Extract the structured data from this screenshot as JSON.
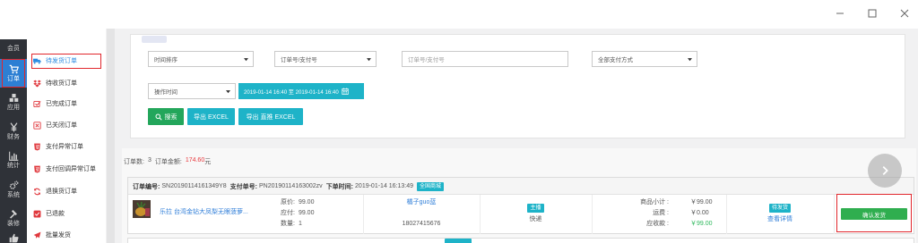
{
  "window_controls": {
    "minimize": "minimize-icon",
    "maximize": "maximize-icon",
    "close": "close-icon"
  },
  "nav": {
    "items": [
      {
        "label": "会员"
      },
      {
        "label": "订单",
        "icon": "cart-icon",
        "active": true
      },
      {
        "label": "应用",
        "icon": "cubes-icon"
      },
      {
        "label": "财务",
        "icon": "yen-icon"
      },
      {
        "label": "统计",
        "icon": "bar-chart-icon"
      },
      {
        "label": "系统",
        "icon": "gears-icon"
      },
      {
        "label": "装修",
        "icon": "hammer-icon"
      },
      {
        "icon": "thumbs-up-icon"
      }
    ]
  },
  "subnav": {
    "items": [
      {
        "label": "待发货订单",
        "icon": "truck-icon",
        "active": true
      },
      {
        "label": "待收货订单",
        "icon": "dropbox-icon"
      },
      {
        "label": "已完成订单",
        "icon": "check-square-icon"
      },
      {
        "label": "已关闭订单",
        "icon": "close-square-icon"
      },
      {
        "label": "支付异常订单",
        "icon": "shield-icon"
      },
      {
        "label": "支付回调异常订单",
        "icon": "shield-icon"
      },
      {
        "label": "退换货订单",
        "icon": "refresh-icon"
      },
      {
        "label": "已退款",
        "icon": "refund-icon"
      },
      {
        "label": "批量发货",
        "icon": "paper-plane-icon"
      }
    ]
  },
  "filters": {
    "sort_select": "时间排序",
    "number_type_select": "订单号/支付号",
    "number_input_placeholder": "订单号/支付号",
    "payment_method_select": "全部支付方式",
    "time_type_select": "操作时间",
    "date_range": "2019-01-14 16:40 至 2019-01-14 16:40",
    "search_button": "搜索",
    "export_button": "导出 EXCEL",
    "export_direct_button": "导出 直推 EXCEL"
  },
  "summary": {
    "count_label": "订单数:",
    "count": "3",
    "amount_label": "订单金额:",
    "amount": "174.60",
    "amount_unit": "元"
  },
  "orders": [
    {
      "order_no_label": "订单编号:",
      "order_no": "SN20190114161349Y8",
      "pay_no_label": "支付单号:",
      "pay_no": "PN20190114163002zv",
      "time_label": "下单时间:",
      "time": "2019-01-14 16:13:49",
      "store_badge": "全国商城",
      "product_name": "乐拉 台湾金钻大凤梨无眼菠萝...",
      "original_price_label": "原价:",
      "original_price": "99.00",
      "payable_label": "应付:",
      "payable": "99.00",
      "quantity_label": "数量:",
      "quantity": "1",
      "buyer_name": "橘子guo蓝",
      "buyer_phone": "18027415676",
      "channel_badge": "主播",
      "shipping": "快递",
      "subtotal_label": "商品小计 :",
      "subtotal": "￥99.00",
      "freight_label": "运费 :",
      "freight": "￥0.00",
      "receivable_label": "应收款 :",
      "receivable": "￥99.00",
      "status_badge": "待发货",
      "detail_link": "查看详情",
      "confirm_button": "确认发货"
    }
  ],
  "colors": {
    "nav_bg": "#2f3238",
    "nav_active": "#2d7fd3",
    "teal": "#1eb3c8",
    "green": "#23a65b",
    "link_blue": "#2f7ed8",
    "amount_red": "#e8393e",
    "highlight_red": "#e1262c"
  }
}
